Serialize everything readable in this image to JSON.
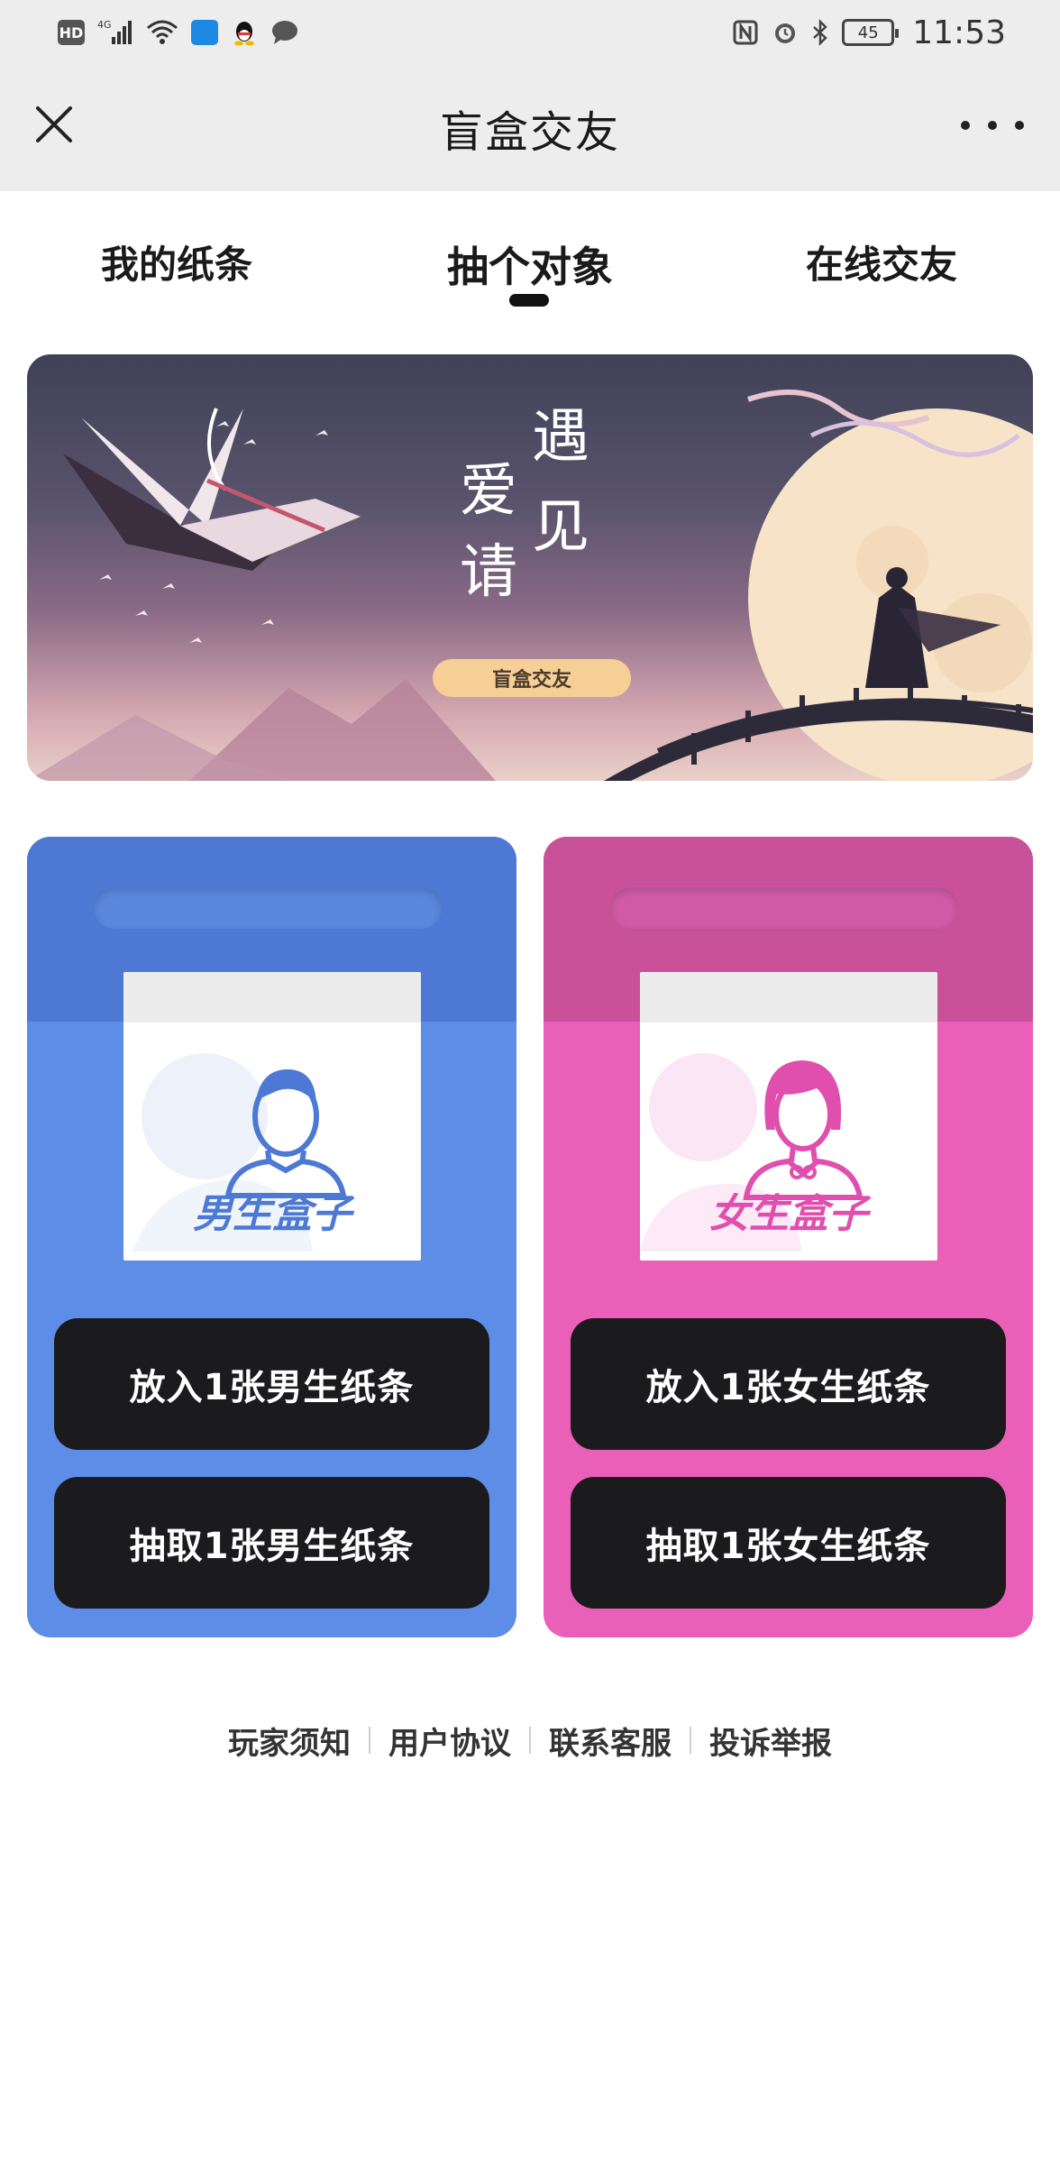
{
  "status_bar": {
    "network": "4G",
    "hd": "HD",
    "time": "11:53",
    "battery": "45",
    "icons": [
      "hd-icon",
      "signal-icon",
      "wifi-icon",
      "app-notification-icon",
      "qq-icon",
      "message-icon",
      "nfc-icon",
      "alarm-icon",
      "bluetooth-icon",
      "battery-icon"
    ]
  },
  "header": {
    "title": "盲盒交友"
  },
  "tabs": [
    {
      "label": "我的纸条",
      "active": false
    },
    {
      "label": "抽个对象",
      "active": true
    },
    {
      "label": "在线交友",
      "active": false
    }
  ],
  "banner": {
    "title_chars": [
      "遇",
      "爱",
      "见",
      "请"
    ],
    "button_label": "盲盒交友"
  },
  "boxes": {
    "male": {
      "label": "男生盒子",
      "put_label": "放入1张男生纸条",
      "draw_label": "抽取1张男生纸条",
      "color": "#5e8de8"
    },
    "female": {
      "label": "女生盒子",
      "put_label": "放入1张女生纸条",
      "draw_label": "抽取1张女生纸条",
      "color": "#ea5fb8"
    }
  },
  "footer": {
    "links": [
      "玩家须知",
      "用户协议",
      "联系客服",
      "投诉举报"
    ]
  }
}
